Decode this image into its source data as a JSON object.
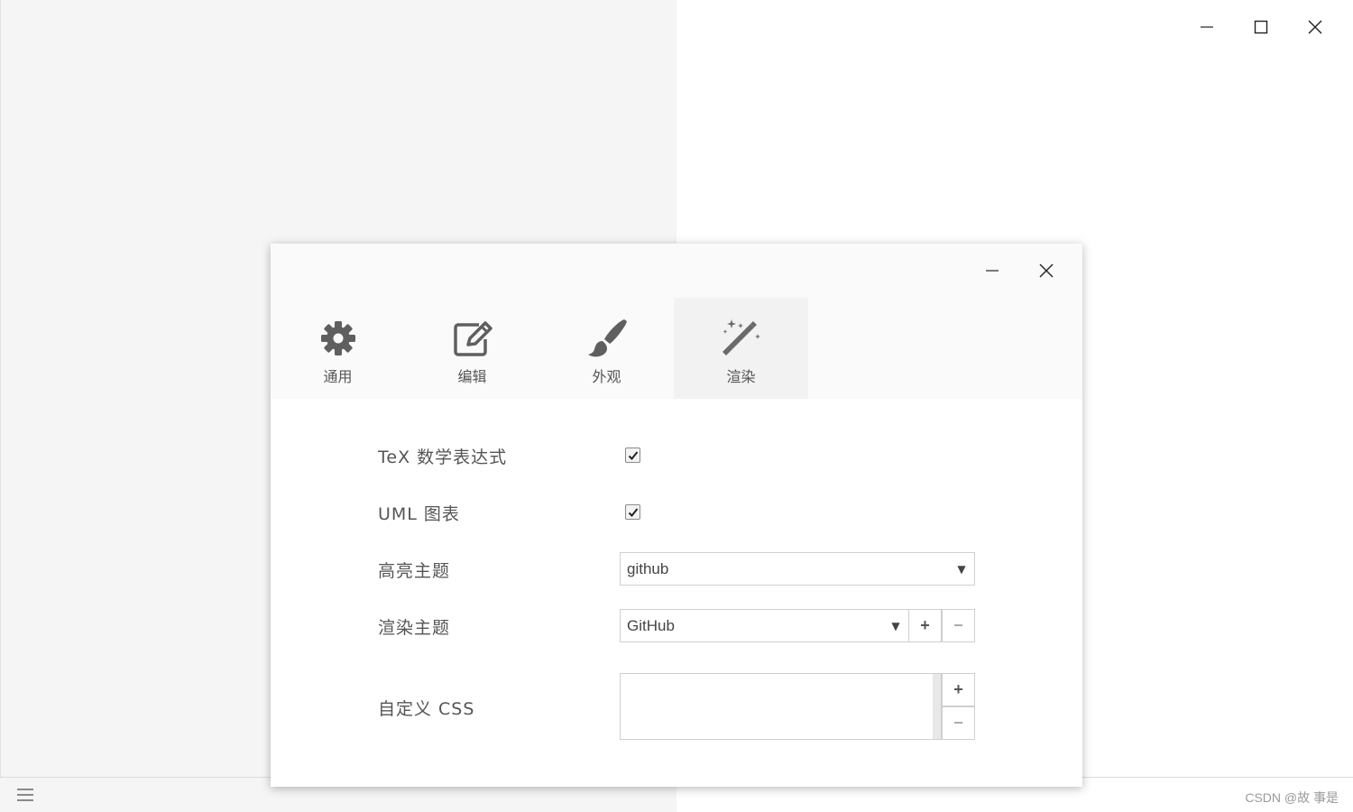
{
  "window": {
    "controls": [
      "minimize-icon",
      "maximize-icon",
      "close-icon"
    ]
  },
  "statusbar": {
    "menu_icon": "hamburger-icon",
    "watermark": "CSDN @故 事是"
  },
  "dialog": {
    "controls": [
      "minimize-icon",
      "close-icon"
    ],
    "tabs": [
      {
        "label": "通用",
        "icon": "gear-icon",
        "active": false
      },
      {
        "label": "编辑",
        "icon": "edit-icon",
        "active": false
      },
      {
        "label": "外观",
        "icon": "paintbrush-icon",
        "active": false
      },
      {
        "label": "渲染",
        "icon": "magic-wand-icon",
        "active": true
      }
    ],
    "settings": {
      "tex": {
        "label": "TeX 数学表达式",
        "checked": true
      },
      "uml": {
        "label": "UML 图表",
        "checked": true
      },
      "highlight_theme": {
        "label": "高亮主题",
        "value": "github"
      },
      "render_theme": {
        "label": "渲染主题",
        "value": "GitHub",
        "add": "+",
        "remove": "−"
      },
      "custom_css": {
        "label": "自定义 CSS",
        "value": "",
        "add": "+",
        "remove": "−"
      }
    }
  },
  "colors": {
    "left_pane": "#f5f5f5",
    "dialog_header": "#fafafa",
    "active_tab": "#f2f2f2",
    "text": "#555555"
  }
}
